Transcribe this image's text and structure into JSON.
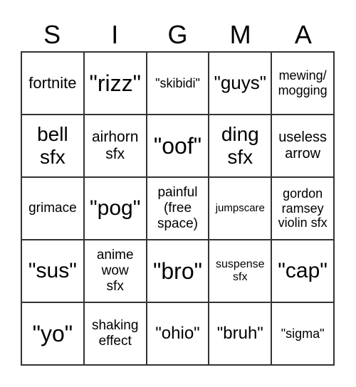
{
  "header": [
    "S",
    "I",
    "G",
    "M",
    "A"
  ],
  "cells": [
    "fortnite",
    "\"rizz\"",
    "\"skibidi\"",
    "\"guys\"",
    "mewing/\nmogging",
    "bell\nsfx",
    "airhorn\nsfx",
    "\"oof\"",
    "ding\nsfx",
    "useless\narrow",
    "grimace",
    "\"pog\"",
    "painful\n(free\nspace)",
    "jumpscare",
    "gordon\nramsey\nviolin sfx",
    "\"sus\"",
    "anime\nwow\nsfx",
    "\"bro\"",
    "suspense\nsfx",
    "\"cap\"",
    "\"yo\"",
    "shaking\neffect",
    "\"ohio\"",
    "\"bruh\"",
    "\"sigma\""
  ]
}
